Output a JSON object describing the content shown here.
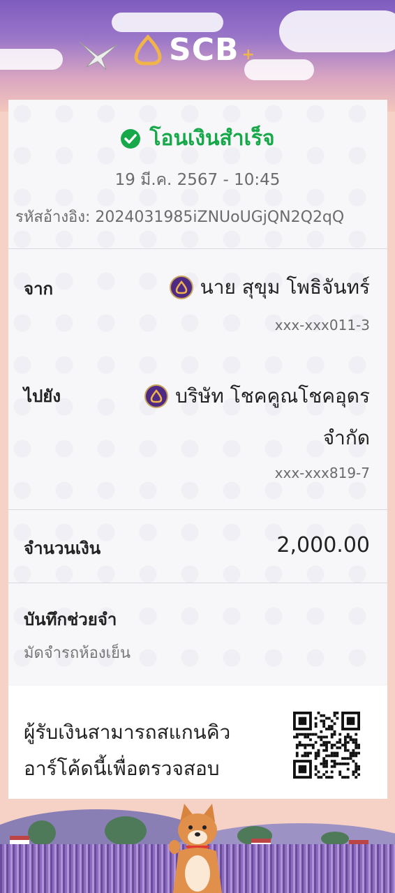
{
  "header": {
    "brand": "SCB",
    "brand_plus": "+"
  },
  "receipt": {
    "status": "โอนเงินสำเร็จ",
    "datetime": "19 มี.ค. 2567 - 10:45",
    "reference": "รหัสอ้างอิง: 2024031985iZNUoUGjQN2Q2qQ",
    "from": {
      "label": "จาก",
      "name": "นาย สุขุม โพธิจันทร์",
      "account": "xxx-xxx011-3"
    },
    "to": {
      "label": "ไปยัง",
      "name_line1": "บริษัท โชคคูณโชคอุดร",
      "name_line2": "จำกัด",
      "account": "xxx-xxx819-7"
    },
    "amount": {
      "label": "จำนวนเงิน",
      "value": "2,000.00"
    },
    "memo": {
      "label": "บันทึกช่วยจำ",
      "value": "มัดจำรถห้องเย็น"
    },
    "qr_note_line1": "ผู้รับเงินสามารถสแกนคิว",
    "qr_note_line2": "อาร์โค้ดนี้เพื่อตรวจสอบ"
  },
  "colors": {
    "success": "#17a84a",
    "brand_purple": "#4e2a84",
    "gold": "#c9a45a"
  }
}
